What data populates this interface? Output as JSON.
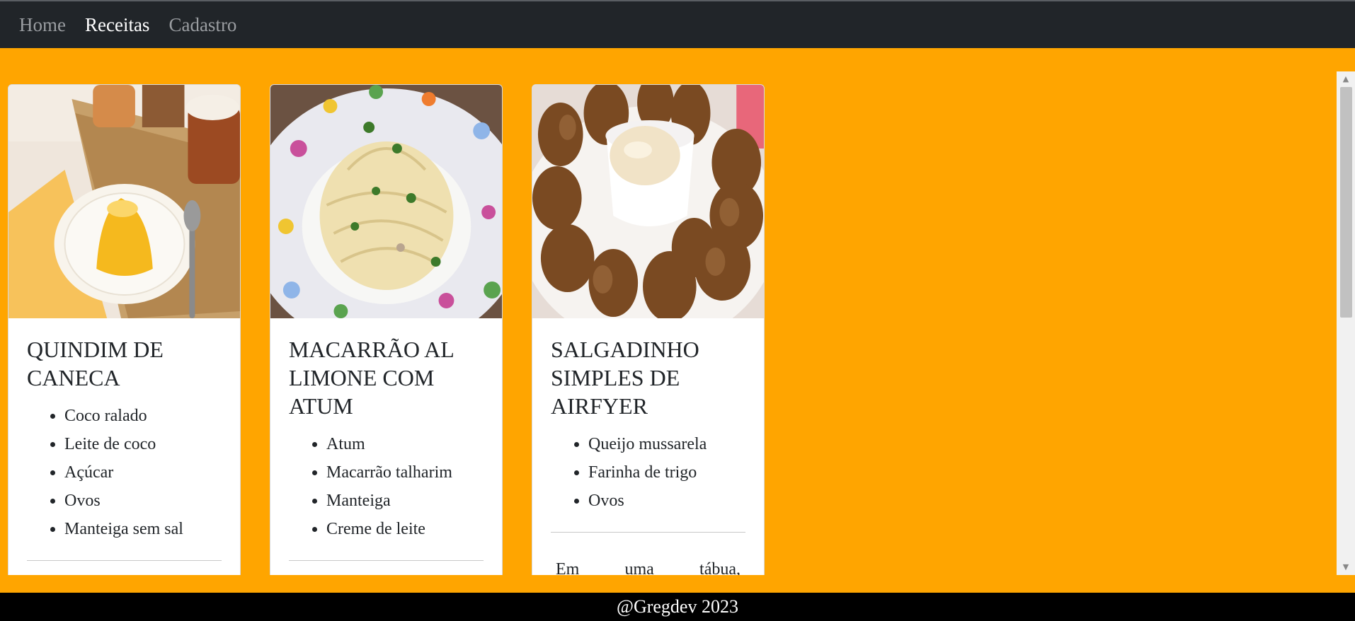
{
  "nav": {
    "items": [
      {
        "label": "Home",
        "active": false
      },
      {
        "label": "Receitas",
        "active": true
      },
      {
        "label": "Cadastro",
        "active": false
      }
    ]
  },
  "recipes": [
    {
      "title": "QUINDIM DE CANECA",
      "image": "quindim-photo",
      "ingredients": [
        "Coco ralado",
        "Leite de coco",
        "Açúcar",
        "Ovos",
        "Manteiga sem sal"
      ],
      "description": ""
    },
    {
      "title": "MACARRÃO AL LIMONE COM ATUM",
      "image": "pasta-photo",
      "ingredients": [
        "Atum",
        "Macarrão talharim",
        "Manteiga",
        "Creme de leite"
      ],
      "description": ""
    },
    {
      "title": "SALGADINHO SIMPLES DE AIRFYER",
      "image": "croquettes-photo",
      "ingredients": [
        "Queijo mussarela",
        "Farinha de trigo",
        "Ovos"
      ],
      "description": "Em uma tábua,"
    }
  ],
  "footer": {
    "text": "@Gregdev 2023"
  },
  "colors": {
    "background": "#ffa500",
    "navbar": "#212529",
    "footer": "#000000"
  }
}
